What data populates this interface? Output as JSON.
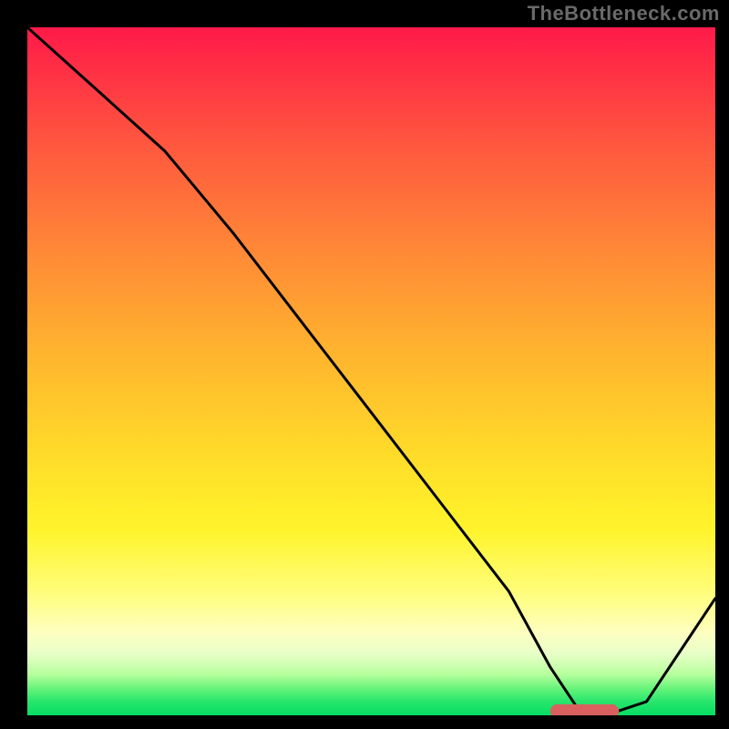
{
  "attribution": "TheBottleneck.com",
  "chart_data": {
    "type": "line",
    "title": "",
    "xlabel": "",
    "ylabel": "",
    "xlim": [
      0,
      100
    ],
    "ylim": [
      0,
      100
    ],
    "series": [
      {
        "name": "bottleneck-curve",
        "x": [
          0,
          10,
          20,
          25,
          30,
          40,
          50,
          60,
          70,
          76,
          80,
          84,
          90,
          100
        ],
        "y": [
          100,
          91,
          82,
          76,
          70,
          57,
          44,
          31,
          18,
          7,
          1,
          0,
          2,
          17
        ]
      }
    ],
    "marker": {
      "name": "optimal-range",
      "color": "#d9605e",
      "x_start": 76,
      "x_end": 86,
      "y": 0.6,
      "thickness_pct": 2.0
    },
    "gradient_stops": [
      {
        "pct": 0,
        "color": "#ff1a49"
      },
      {
        "pct": 18,
        "color": "#ff5a3e"
      },
      {
        "pct": 48,
        "color": "#ffb62e"
      },
      {
        "pct": 73,
        "color": "#fff42b"
      },
      {
        "pct": 90,
        "color": "#fdffc0"
      },
      {
        "pct": 100,
        "color": "#07dd64"
      }
    ]
  }
}
